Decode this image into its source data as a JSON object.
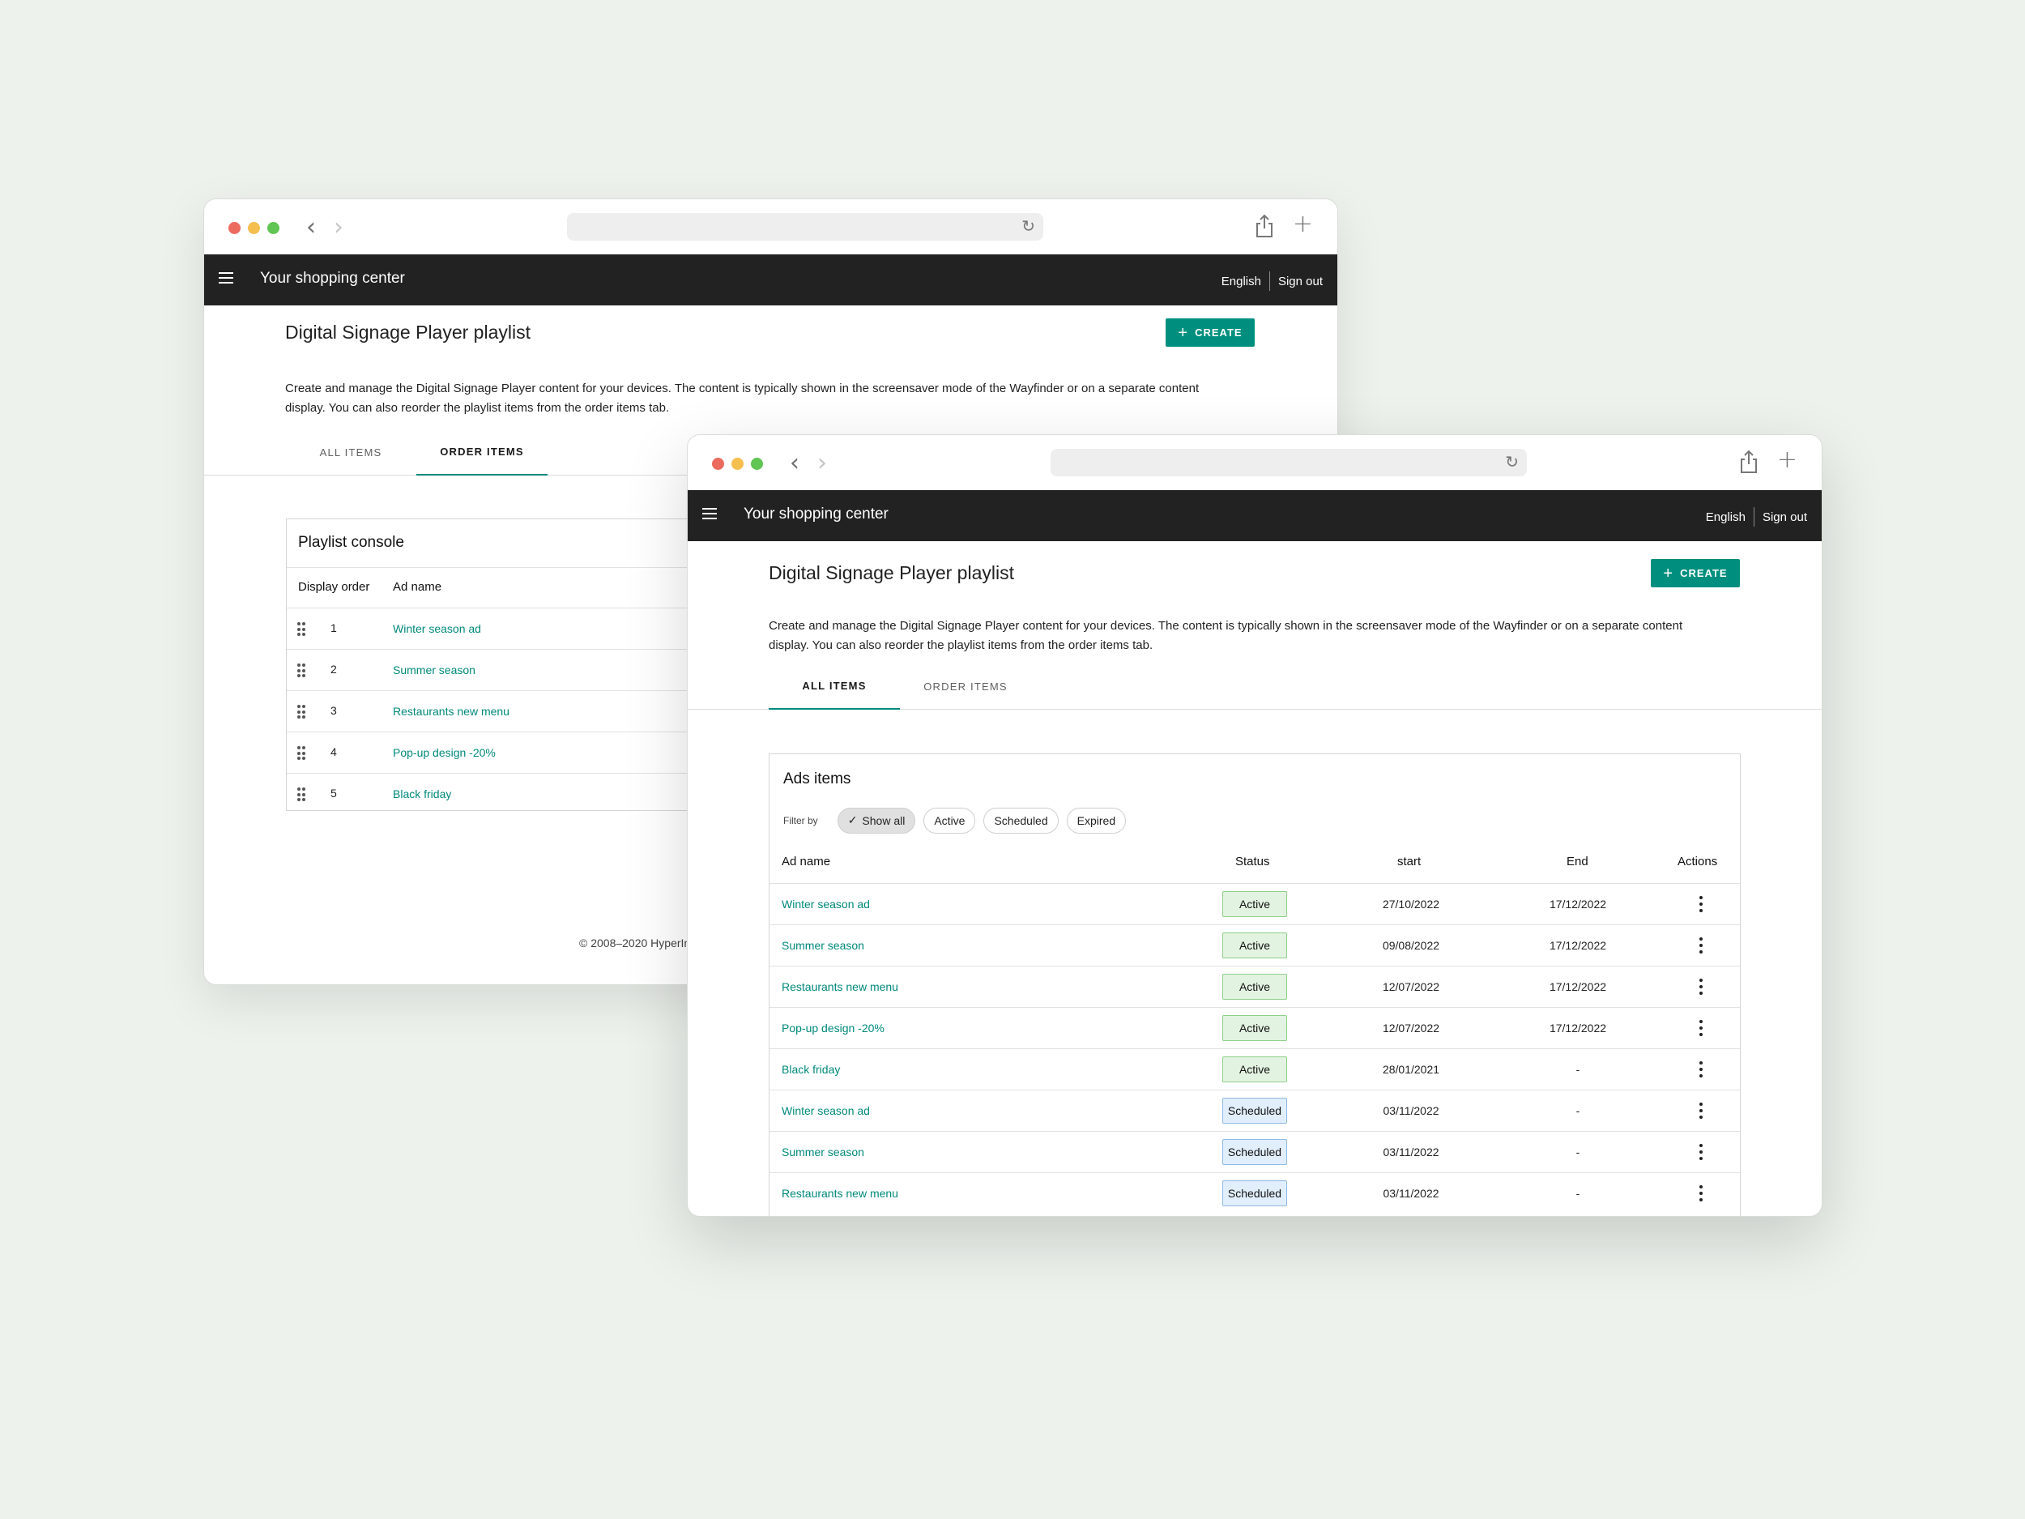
{
  "app": {
    "title": "Your shopping center",
    "language": "English",
    "sign_out": "Sign out"
  },
  "page": {
    "title": "Digital Signage Player playlist",
    "create_label": "CREATE",
    "description": "Create and manage the Digital Signage Player content for your devices. The content is typically shown in the screensaver mode of the Wayfinder or on a separate content display. You can also reorder the playlist items from the order items tab.",
    "tabs": [
      "ALL ITEMS",
      "ORDER ITEMS"
    ]
  },
  "back_window": {
    "active_tab": "ORDER ITEMS",
    "playlist_console": {
      "title": "Playlist console",
      "columns": [
        "Display order",
        "Ad name"
      ],
      "rows": [
        {
          "order": "1",
          "name": "Winter season ad"
        },
        {
          "order": "2",
          "name": "Summer season"
        },
        {
          "order": "3",
          "name": "Restaurants new menu"
        },
        {
          "order": "4",
          "name": "Pop-up design -20%"
        },
        {
          "order": "5",
          "name": "Black friday"
        }
      ]
    },
    "footer": "© 2008–2020 HyperIn"
  },
  "front_window": {
    "active_tab": "ALL ITEMS",
    "ads_items": {
      "title": "Ads items",
      "filter_label": "Filter by",
      "filters": [
        "Show all",
        "Active",
        "Scheduled",
        "Expired"
      ],
      "selected_filter": "Show all",
      "columns": [
        "Ad name",
        "Status",
        "start",
        "End",
        "Actions"
      ],
      "rows": [
        {
          "name": "Winter season ad",
          "status": "Active",
          "start": "27/10/2022",
          "end": "17/12/2022"
        },
        {
          "name": "Summer season",
          "status": "Active",
          "start": "09/08/2022",
          "end": "17/12/2022"
        },
        {
          "name": "Restaurants new menu",
          "status": "Active",
          "start": "12/07/2022",
          "end": "17/12/2022"
        },
        {
          "name": "Pop-up design -20%",
          "status": "Active",
          "start": "12/07/2022",
          "end": "17/12/2022"
        },
        {
          "name": "Black friday",
          "status": "Active",
          "start": "28/01/2021",
          "end": "-"
        },
        {
          "name": "Winter season ad",
          "status": "Scheduled",
          "start": "03/11/2022",
          "end": "-"
        },
        {
          "name": "Summer season",
          "status": "Scheduled",
          "start": "03/11/2022",
          "end": "-"
        },
        {
          "name": "Restaurants new menu",
          "status": "Scheduled",
          "start": "03/11/2022",
          "end": "-"
        }
      ]
    }
  },
  "colors": {
    "accent": "#00897b",
    "appbar": "#222222",
    "active_badge": "#e3f3e1",
    "scheduled_badge": "#e1eefb",
    "background": "#edf2ec"
  },
  "icons": [
    "menu-icon",
    "back-arrow-icon",
    "forward-arrow-icon",
    "reload-icon",
    "share-icon",
    "new-tab-icon",
    "plus-icon",
    "drag-handle-icon",
    "check-icon",
    "more-vert-icon"
  ]
}
